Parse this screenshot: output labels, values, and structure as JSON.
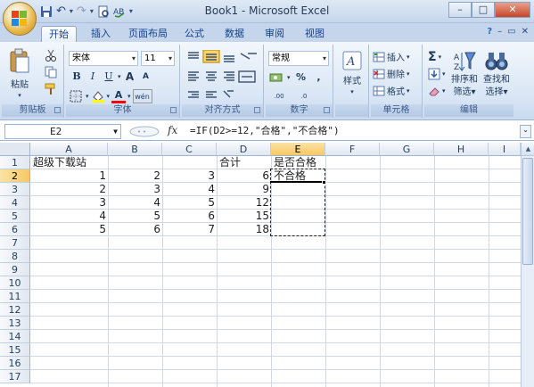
{
  "window": {
    "title": "Book1 - Microsoft Excel",
    "minimize": "–",
    "restore": "□",
    "close": "✕"
  },
  "qat": {
    "save_icon": "save-icon",
    "undo": "↶",
    "redo": "↷",
    "customize": "▾"
  },
  "tabs": [
    {
      "label": "开始",
      "active": true
    },
    {
      "label": "插入",
      "active": false
    },
    {
      "label": "页面布局",
      "active": false
    },
    {
      "label": "公式",
      "active": false
    },
    {
      "label": "数据",
      "active": false
    },
    {
      "label": "审阅",
      "active": false
    },
    {
      "label": "视图",
      "active": false
    }
  ],
  "ribbon": {
    "clipboard": {
      "label": "剪贴板",
      "paste": "粘贴"
    },
    "font": {
      "label": "字体",
      "name": "宋体",
      "size": "11",
      "bold": "B",
      "italic": "I",
      "underline": "U",
      "grow": "A",
      "shrink": "A",
      "fill_color": "#ffff00",
      "font_color": "#ff0000",
      "phonetic": "wén"
    },
    "alignment": {
      "label": "对齐方式"
    },
    "number": {
      "label": "数字",
      "format": "常规",
      "percent": "%",
      "comma": ",",
      "inc_decimal": ".00",
      "dec_decimal": ".0"
    },
    "styles": {
      "label": "样式"
    },
    "cells": {
      "label": "单元格",
      "insert": "插入",
      "delete": "删除",
      "format": "格式"
    },
    "editing": {
      "label": "编辑",
      "sort_filter": "排序和",
      "sort_filter2": "筛选",
      "find_select": "查找和",
      "find_select2": "选择"
    }
  },
  "formula_bar": {
    "name_box": "E2",
    "fx": "fx",
    "formula": "=IF(D2>=12,\"合格\",\"不合格\")"
  },
  "columns": [
    "A",
    "B",
    "C",
    "D",
    "E",
    "F",
    "G",
    "H",
    "I"
  ],
  "rows": [
    "1",
    "2",
    "3",
    "4",
    "5",
    "6",
    "7",
    "8",
    "9",
    "10",
    "11",
    "12",
    "13",
    "14",
    "15",
    "16",
    "17"
  ],
  "cells": {
    "A1": "超级下载站",
    "D1": "合计",
    "E1": "是否合格",
    "A2": "1",
    "B2": "2",
    "C2": "3",
    "D2": "6",
    "E2": "不合格",
    "A3": "2",
    "B3": "3",
    "C3": "4",
    "D3": "9",
    "A4": "3",
    "B4": "4",
    "C4": "5",
    "D4": "12",
    "A5": "4",
    "B5": "5",
    "C5": "6",
    "D5": "15",
    "A6": "5",
    "B6": "6",
    "C6": "7",
    "D6": "18"
  },
  "selection": {
    "active_cell": "E2",
    "copy_range": "E2:E6"
  },
  "colors": {
    "ribbon_bg": "#d9e6f5",
    "tab_text": "#15428b",
    "header_selected": "#f6c862",
    "gridline": "#d0d7e5"
  }
}
